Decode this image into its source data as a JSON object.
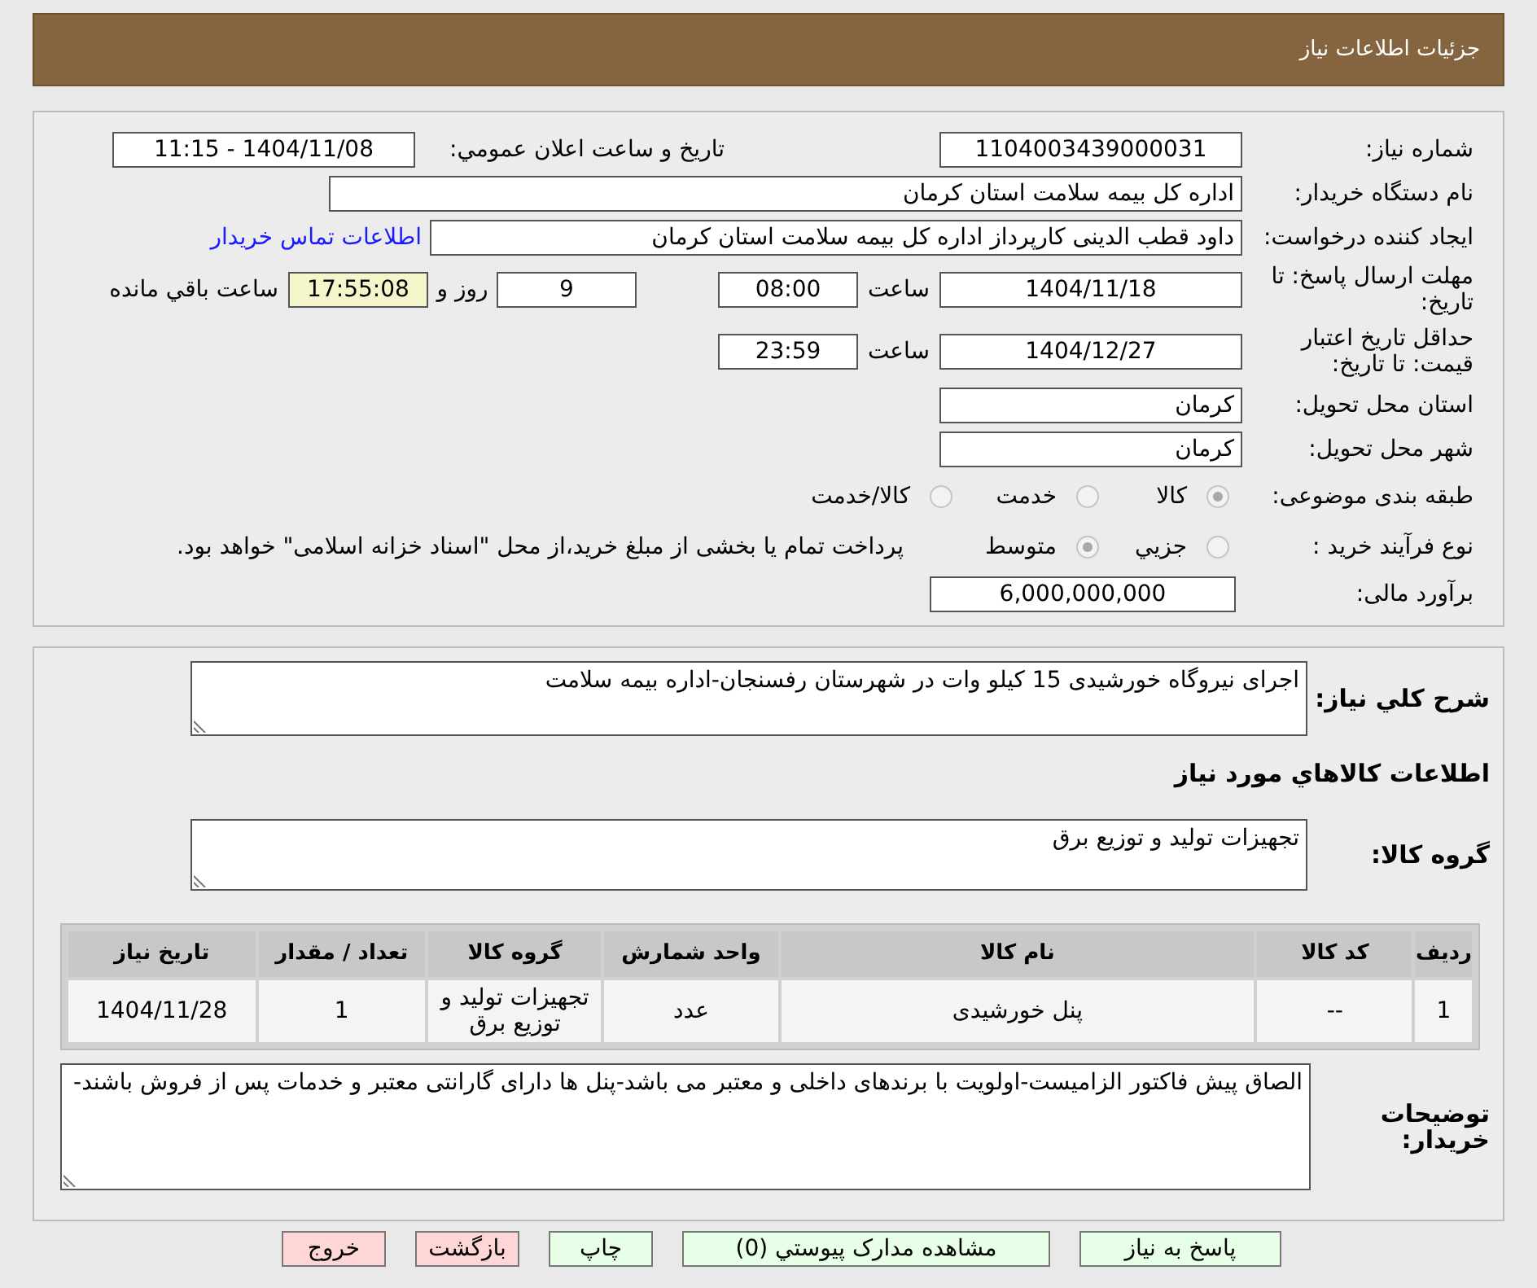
{
  "header": {
    "title": "جزئیات اطلاعات نیاز"
  },
  "need_number": {
    "label": "شماره نیاز:",
    "value": "1104003439000031"
  },
  "announce": {
    "label": "تاریخ و ساعت اعلان عمومي:",
    "value": "1404/11/08 - 11:15"
  },
  "buyer_org": {
    "label": "نام دستگاه خریدار:",
    "value": "اداره کل بیمه سلامت استان کرمان"
  },
  "requester": {
    "label": "ایجاد کننده درخواست:",
    "value": "داود قطب الدینی کارپرداز اداره کل بیمه سلامت استان کرمان",
    "link": "اطلاعات تماس خریدار"
  },
  "deadline": {
    "label": "مهلت ارسال پاسخ: تا تاریخ:",
    "date": "1404/11/18",
    "time_label": "ساعت",
    "time": "08:00",
    "days": "9",
    "days_label": "روز و",
    "remaining": "17:55:08",
    "remaining_label": "ساعت باقي مانده"
  },
  "validity": {
    "label": "حداقل تاریخ اعتبار قیمت: تا تاریخ:",
    "date": "1404/12/27",
    "time_label": "ساعت",
    "time": "23:59"
  },
  "province": {
    "label": "استان محل تحویل:",
    "value": "کرمان"
  },
  "city": {
    "label": "شهر محل تحویل:",
    "value": "کرمان"
  },
  "category": {
    "label": "طبقه بندی موضوعی:",
    "options": [
      {
        "label": "کالا",
        "selected": true
      },
      {
        "label": "خدمت",
        "selected": false
      },
      {
        "label": "کالا/خدمت",
        "selected": false
      }
    ]
  },
  "process": {
    "label": "نوع فرآیند خرید :",
    "options": [
      {
        "label": "جزيي",
        "selected": false
      },
      {
        "label": "متوسط",
        "selected": true
      }
    ],
    "note": "پرداخت تمام یا بخشی از مبلغ خرید،از محل \"اسناد خزانه اسلامی\" خواهد بود."
  },
  "budget": {
    "label": "برآورد مالی:",
    "value": "6,000,000,000"
  },
  "description": {
    "label": "شرح کلي نیاز:",
    "value": "اجرای نیروگاه خورشیدی 15 کیلو وات در شهرستان رفسنجان-اداره بیمه سلامت"
  },
  "goods_heading": "اطلاعات کالاهاي مورد نياز",
  "goods_group": {
    "label": "گروه کالا:",
    "value": "تجهیزات تولید و توزیع برق"
  },
  "table": {
    "columns": [
      "ردیف",
      "کد کالا",
      "نام کالا",
      "واحد شمارش",
      "گروه کالا",
      "تعداد / مقدار",
      "تاریخ نیاز"
    ],
    "rows": [
      [
        "1",
        "--",
        "پنل خورشیدی",
        "عدد",
        "تجهیزات تولید و توزیع برق",
        "1",
        "1404/11/28"
      ]
    ]
  },
  "buyer_notes": {
    "label": "توضیحات خریدار:",
    "value": "الصاق پیش فاکتور الزامیست-اولویت با برندهای داخلی و معتبر می باشد-پنل ها دارای گارانتی معتبر و خدمات پس از فروش باشند-"
  },
  "buttons": [
    {
      "label": "پاسخ به نیاز",
      "kind": "action"
    },
    {
      "label": "مشاهده مدارک پیوستي (0)",
      "kind": "action"
    },
    {
      "label": "چاپ",
      "kind": "action"
    },
    {
      "label": "بازگشت",
      "kind": "exit"
    },
    {
      "label": "خروج",
      "kind": "exit"
    }
  ]
}
